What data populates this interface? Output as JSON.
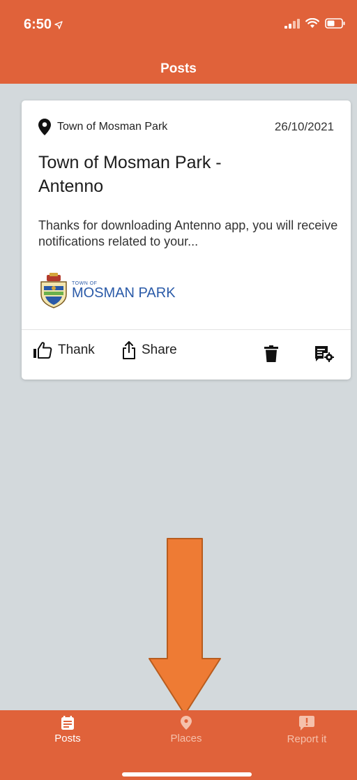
{
  "status_bar": {
    "time": "6:50",
    "icons": [
      "location-arrow-icon",
      "cellular-signal-icon",
      "wifi-icon",
      "battery-icon"
    ]
  },
  "header": {
    "title": "Posts"
  },
  "post": {
    "place": "Town of Mosman Park",
    "date": "26/10/2021",
    "title": "Town of Mosman Park - Antenno",
    "excerpt": "Thanks for downloading Antenno app, you will receive notifications related to your...",
    "logo": {
      "small_text": "TOWN OF",
      "big_text": "MOSMAN PARK"
    },
    "actions": {
      "thank": "Thank",
      "share": "Share"
    },
    "action_icons": [
      "thumbs-up-icon",
      "share-icon",
      "trash-icon",
      "post-settings-icon"
    ]
  },
  "overlay": {
    "icon": "down-arrow-annotation"
  },
  "tabbar": {
    "tabs": [
      {
        "label": "Posts",
        "icon": "calendar-icon",
        "active": true
      },
      {
        "label": "Places",
        "icon": "map-pin-icon",
        "active": false
      },
      {
        "label": "Report it",
        "icon": "report-alert-icon",
        "active": false
      }
    ]
  },
  "colors": {
    "accent": "#e0623a",
    "background": "#d3d9dc",
    "arrow": "#ee7b34",
    "logo_blue": "#2a5aa8"
  }
}
